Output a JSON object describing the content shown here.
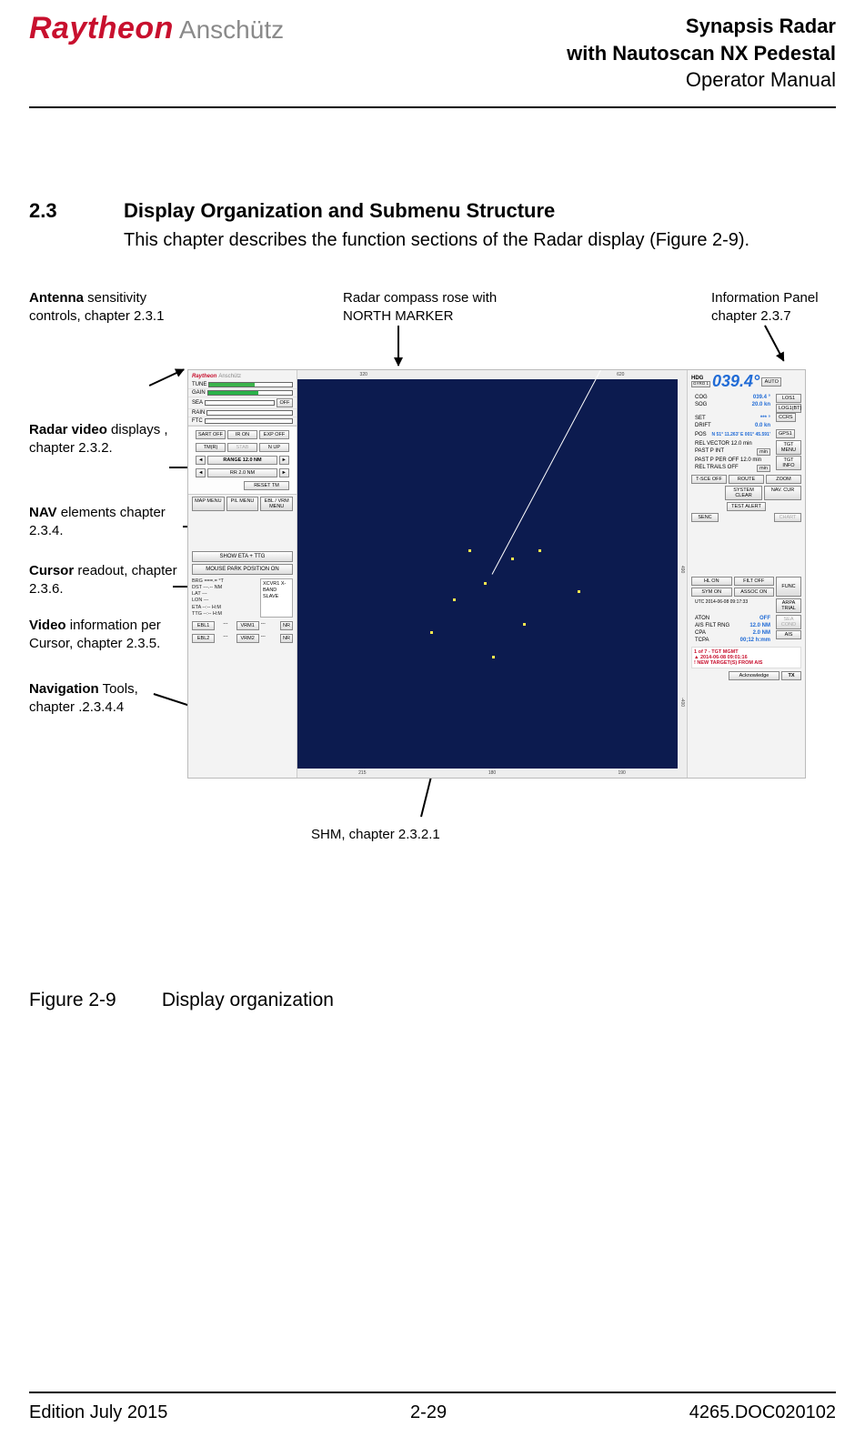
{
  "header": {
    "logo_raytheon": "Raytheon",
    "logo_anschuetz": "Anschütz",
    "title": "Synapsis Radar",
    "subtitle": "with Nautoscan NX Pedestal",
    "manual": "Operator Manual"
  },
  "section": {
    "number": "2.3",
    "title": "Display Organization and Submenu Structure",
    "desc": "This chapter describes the function sections of the Radar display (Figure 2-9)."
  },
  "callouts": {
    "antenna_b": "Antenna",
    "antenna_r": " sensitivity controls, chapter 2.3.1",
    "compass": "Radar compass rose with NORTH MARKER",
    "info": "Information Panel chapter 2.3.7",
    "video_b": "Radar video",
    "video_r": " displays , chapter 2.3.2.",
    "nav_b": "NAV",
    "nav_r": " elements chapter 2.3.4.",
    "cursor_b": "Cursor",
    "cursor_r": " readout, chapter 2.3.6.",
    "vinfo_b": "Video",
    "vinfo_r": " information per Cursor, chapter 2.3.5.",
    "navtools_b": "Navigation",
    "navtools_r": " Tools, chapter .2.3.4.4",
    "shm": "SHM, chapter 2.3.2.1"
  },
  "radar": {
    "brand_r": "Raytheon",
    "brand_a": "Anschütz",
    "tune": "TUNE",
    "gain": "GAIN",
    "sea": "SEA",
    "rain": "RAIN",
    "ftc": "FTC",
    "off": "OFF",
    "sart_off": "SART OFF",
    "ir_on": "IR ON",
    "exp_off": "EXP OFF",
    "tmr": "TM(R)",
    "stab": "STAB",
    "nup": "N UP",
    "range_lbl": "RANGE 12.0 NM",
    "rr": "RR 2.0 NM",
    "reset_tm": "RESET TM",
    "map_menu": "MAP MENU",
    "pil_menu": "PIL MENU",
    "ebl_vrm_menu": "EBL / VRM MENU",
    "show_eta": "SHOW ETA + TTG",
    "mouse_park": "MOUSE PARK POSITION ON",
    "xcvr_box": "XCVR1 X-BAND SLAVE",
    "list_lines": [
      "BRG  ===.=  °T",
      "DST  ---.--  NM",
      "LAT  ---",
      "LON  ---",
      "ETA  --:--  H:M",
      "TTG  --:--  H:M"
    ],
    "ebl1": "EBL1",
    "ebl2": "EBL2",
    "vrm1": "VRM1",
    "vrm2": "VRM2",
    "nr": "NR",
    "ruler_top": [
      "320",
      "620"
    ],
    "ruler_bot": [
      "215",
      "180",
      "190"
    ],
    "ruler_right": [
      "",
      "490",
      "-400"
    ]
  },
  "rp": {
    "hdg_lbl": "HDG",
    "hdg_src": "GYRO 1",
    "hdg_val": "039.4°",
    "auto": "AUTO",
    "cog": "COG",
    "cog_v": "039.4 °",
    "sog": "SOG",
    "sog_v": "20.0 kn",
    "set": "SET",
    "set_v": "*** °",
    "drift": "DRIFT",
    "drift_v": "0.0  kn",
    "pos": "POS",
    "pos_v": "N 51° 11.263' E 001° 45.591'",
    "los1": "LOS1",
    "logbt1": "LOG1(BT)",
    "ccrs": "CCRS",
    "gps1": "GPS1",
    "rel_vector": "REL  VECTOR  12.0  min",
    "past_p_int": "PAST P INT",
    "past_p_per": "PAST P PER  OFF 12.0 min",
    "rel_trails": "REL  TRAILS  OFF",
    "tgt_menu": "TGT MENU",
    "tgt_info": "TGT INFO",
    "tsce_off": "T-SCE OFF",
    "route": "ROUTE",
    "zoom": "ZOOM",
    "system_clear": "SYSTEM CLEAR",
    "nav_cur": "NAV. CUR",
    "test_alert": "TEST ALERT",
    "senc": "SENC",
    "chart": "CHART",
    "hl_on": "HL ON",
    "filt_off": "FILT OFF",
    "func": "FUNC",
    "sym_on": "SYM ON",
    "assoc_on": "ASSOC ON",
    "utc": "UTC   2014-06-08  09:17:33",
    "arpa_trial": "ARPA TRIAL",
    "aton": "ATON",
    "aton_v": "OFF",
    "ais_filt": "AIS FILT RNG",
    "ais_filt_v": "12.0   NM",
    "cpa": "CPA",
    "cpa_v": "2.0   NM",
    "tcpa": "TCPA",
    "tcpa_v": "00;12 h:mm",
    "ais": "AIS",
    "alert1": "1 of 7 - TGT MGMT",
    "alert2": "2014-06-08 09:01:16",
    "alert3": "! NEW TARGET(S) FROM AIS",
    "ack": "Acknowledge",
    "tx": "TX"
  },
  "figure": {
    "num": "Figure 2-9",
    "title": "Display organization"
  },
  "footer": {
    "edition": "Edition July 2015",
    "page": "2-29",
    "doc": "4265.DOC020102"
  }
}
